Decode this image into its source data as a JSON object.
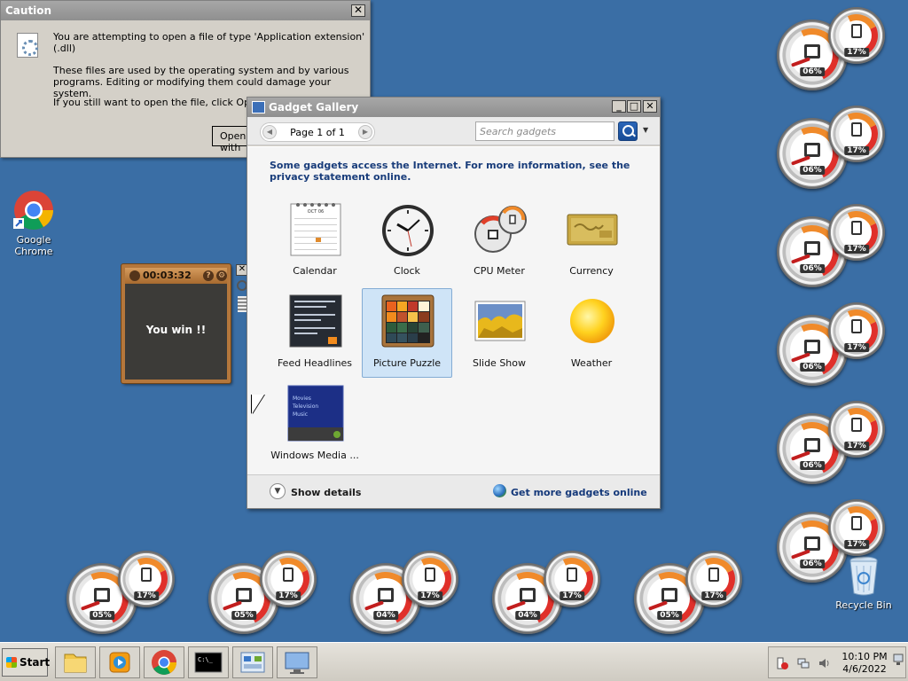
{
  "desktop": {
    "chrome_label": "Google Chrome",
    "recycle_label": "Recycle Bin"
  },
  "cpu_meters": [
    {
      "cpu": "06%",
      "mem": "17%"
    },
    {
      "cpu": "06%",
      "mem": "17%"
    },
    {
      "cpu": "06%",
      "mem": "17%"
    },
    {
      "cpu": "06%",
      "mem": "17%"
    },
    {
      "cpu": "06%",
      "mem": "17%"
    },
    {
      "cpu": "06%",
      "mem": "17%"
    },
    {
      "cpu": "05%",
      "mem": "17%"
    },
    {
      "cpu": "05%",
      "mem": "17%"
    },
    {
      "cpu": "04%",
      "mem": "17%"
    },
    {
      "cpu": "04%",
      "mem": "17%"
    },
    {
      "cpu": "05%",
      "mem": "17%"
    }
  ],
  "caution": {
    "title": "Caution",
    "line1": "You are attempting to open a file of type 'Application extension' (.dll)",
    "line2": "These files are used by the operating system and by various programs. Editing or modifying them could damage your system.",
    "line3": "If you still want to open the file, click Open with Cancel.",
    "open_button": "Open with"
  },
  "gallery": {
    "title": "Gadget Gallery",
    "page_label": "Page 1 of 1",
    "search_placeholder": "Search gadgets",
    "notice": "Some gadgets access the Internet.  For more information, see the privacy statement online.",
    "show_details": "Show details",
    "more_gadgets": "Get more gadgets online",
    "gadgets": [
      {
        "name": "Calendar",
        "icon": "calendar-icon"
      },
      {
        "name": "Clock",
        "icon": "clock-icon"
      },
      {
        "name": "CPU Meter",
        "icon": "cpu-meter-icon"
      },
      {
        "name": "Currency",
        "icon": "currency-icon"
      },
      {
        "name": "Feed Headlines",
        "icon": "feed-icon"
      },
      {
        "name": "Picture Puzzle",
        "icon": "puzzle-icon"
      },
      {
        "name": "Slide Show",
        "icon": "slideshow-icon"
      },
      {
        "name": "Weather",
        "icon": "weather-icon"
      },
      {
        "name": "Windows Media ...",
        "icon": "media-center-icon"
      }
    ],
    "calendar_month": "OCT 06",
    "media_lines": [
      "Movies",
      "Television",
      "Music"
    ]
  },
  "timer": {
    "time": "00:03:32",
    "message": "You win !!"
  },
  "taskbar": {
    "start": "Start",
    "time": "10:10 PM",
    "date": "4/6/2022"
  }
}
